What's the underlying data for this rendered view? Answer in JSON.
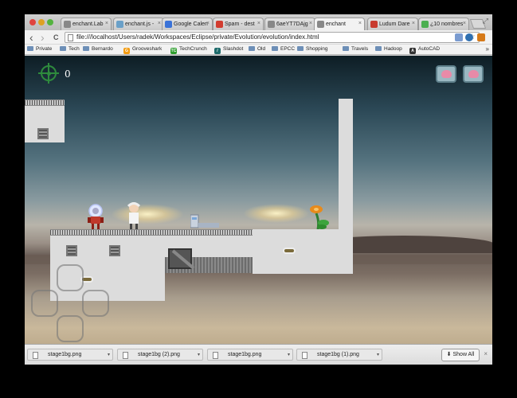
{
  "tabs": [
    {
      "label": "enchant.Lab",
      "favicon": "page-icon",
      "color": "#888888"
    },
    {
      "label": "enchant.js -",
      "favicon": "enchant-icon",
      "color": "#6aa0c8"
    },
    {
      "label": "Google Calen",
      "favicon": "calendar-icon",
      "color": "#3b73d8"
    },
    {
      "label": "Spam - dest",
      "favicon": "gmail-icon",
      "color": "#d23d30"
    },
    {
      "label": "6aeYT7DAjg",
      "favicon": "page-icon",
      "color": "#888888"
    },
    {
      "label": "enchant",
      "favicon": "page-icon",
      "color": "#888888",
      "active": true
    },
    {
      "label": "Ludum Dare",
      "favicon": "ludum-icon",
      "color": "#c83a2e"
    },
    {
      "label": "¿10 nombres",
      "favicon": "feedly-icon",
      "color": "#4caf50"
    }
  ],
  "url": "file:///localhost/Users/radek/Workspaces/Eclipse/private/Evolution/evolution/index.html",
  "bookmarks": [
    {
      "label": "Private",
      "type": "folder"
    },
    {
      "label": "Tech",
      "type": "folder"
    },
    {
      "label": "Bernardo",
      "type": "folder"
    },
    {
      "label": "Grooveshark",
      "type": "site",
      "color": "#f39c12",
      "glyph": "G"
    },
    {
      "label": "TechCrunch",
      "type": "site",
      "color": "#2e9e2e",
      "glyph": "TC"
    },
    {
      "label": "Slashdot",
      "type": "site",
      "color": "#1d6b6b",
      "glyph": "/"
    },
    {
      "label": "Old",
      "type": "folder"
    },
    {
      "label": "EPCC",
      "type": "folder"
    },
    {
      "label": "Shopping",
      "type": "folder"
    },
    {
      "label": "Travels",
      "type": "folder"
    },
    {
      "label": "Hadoop",
      "type": "folder"
    },
    {
      "label": "AutoCAD",
      "type": "site",
      "color": "#333333",
      "glyph": "A"
    }
  ],
  "bookmarks_more": "»",
  "game": {
    "score": "0"
  },
  "downloads": [
    {
      "name": "stage1bg.png"
    },
    {
      "name": "stage1bg (2).png"
    },
    {
      "name": "stage1bg.png"
    },
    {
      "name": "stage1bg (1).png"
    }
  ],
  "show_all_label": "Show All",
  "icons": {
    "back": "‹",
    "forward": "›",
    "reload": "C",
    "star": "☆",
    "close": "×",
    "caret": "▾",
    "download_arrow": "⬇"
  }
}
